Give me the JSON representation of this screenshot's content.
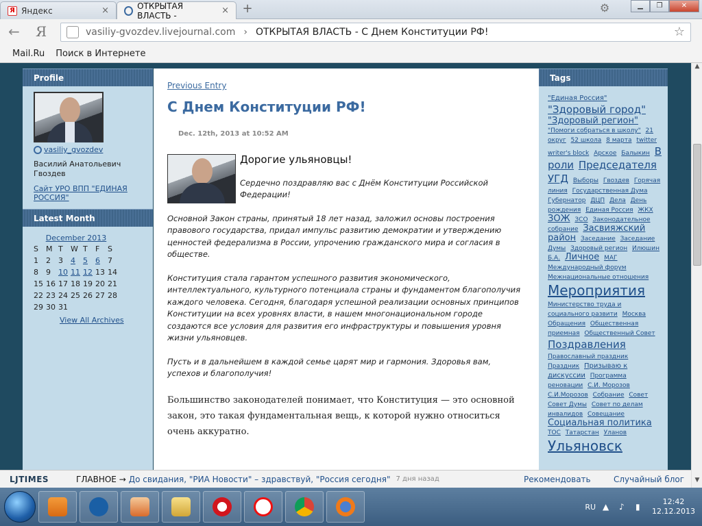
{
  "browser": {
    "tabs": [
      {
        "label": "Яндекс"
      },
      {
        "label": "ОТКРЫТАЯ ВЛАСТЬ - "
      }
    ],
    "new_tab_symbol": "+",
    "address_host": "vasiliy-gvozdev.livejournal.com",
    "address_separator": "›",
    "address_title": "ОТКРЫТАЯ ВЛАСТЬ - С Днем Конституции РФ!",
    "ya_button": "Я",
    "bookmarks": [
      "Mail.Ru",
      "Поиск в Интернете"
    ]
  },
  "sidebar_left": {
    "profile_heading": "Profile",
    "username": "vasiliy_gvozdev",
    "full_name": "Василий Анатольевич Гвоздев",
    "site_link": "Сайт УРО ВПП \"ЕДИНАЯ РОССИЯ\"",
    "latest_month_heading": "Latest Month",
    "calendar": {
      "month": "December 2013",
      "weekdays": [
        "S",
        "M",
        "T",
        "W",
        "T",
        "F",
        "S"
      ],
      "days": [
        [
          "1",
          "2",
          "3",
          "4",
          "5",
          "6",
          "7"
        ],
        [
          "8",
          "9",
          "10",
          "11",
          "12",
          "13",
          "14"
        ],
        [
          "15",
          "16",
          "17",
          "18",
          "19",
          "20",
          "21"
        ],
        [
          "22",
          "23",
          "24",
          "25",
          "26",
          "27",
          "28"
        ],
        [
          "29",
          "30",
          "31",
          "",
          "",
          "",
          ""
        ]
      ],
      "linked_days": [
        "4",
        "5",
        "6",
        "10",
        "11",
        "12"
      ],
      "view_all": "View All Archives"
    }
  },
  "entry": {
    "prev_entry": "Previous Entry",
    "title": "С Днем Конституции РФ!",
    "date": "Dec. 12th, 2013 at 10:52 AM",
    "greeting": "Дорогие ульяновцы!",
    "intro": "Сердечно поздравляю вас с Днём Конституции Российской Федерации!",
    "paragraphs": [
      "Основной Закон страны, принятый 18 лет назад, заложил основы построения правового государства, придал импульс развитию демократии и утверждению ценностей федерализма в России, упрочению гражданского мира и согласия в обществе.",
      "Конституция стала гарантом успешного развития экономического, интеллектуального, культурного потенциала страны и фундаментом благополучия каждого человека. Сегодня, благодаря успешной реализации основных принципов Конституции на всех уровнях власти, в нашем многонациональном городе создаются все условия для развития его инфраструктуры и повышения уровня жизни ульяновцев.",
      "Пусть и в дальнейшем в каждой семье царят мир и гармония. Здоровья вам, успехов и благополучия!"
    ],
    "closing": "Большинство законодателей понимает, что Конституция — это основной закон, это такая  фундаментальная вещь, к которой нужно относиться очень аккуратно."
  },
  "sidebar_right": {
    "tags_heading": "Tags",
    "tags": [
      {
        "t": "\"Единая Россия\"",
        "s": 2
      },
      {
        "t": "\"Здоровый город\"",
        "s": 4
      },
      {
        "t": "\"Здоровый регион\"",
        "s": 3
      },
      {
        "t": "\"Помоги собраться в школу\"",
        "s": 1
      },
      {
        "t": "21 округ",
        "s": 1
      },
      {
        "t": "52 школа",
        "s": 1
      },
      {
        "t": "8 марта",
        "s": 1
      },
      {
        "t": "twitter",
        "s": 1
      },
      {
        "t": "writer's block",
        "s": 1
      },
      {
        "t": "Арское",
        "s": 1
      },
      {
        "t": "Балыкин",
        "s": 1
      },
      {
        "t": "В роли",
        "s": 4
      },
      {
        "t": "Председателя УГД",
        "s": 4
      },
      {
        "t": "Выборы",
        "s": 1
      },
      {
        "t": "Гвоздев",
        "s": 1
      },
      {
        "t": "Горячая линия",
        "s": 1
      },
      {
        "t": "Государственная Дума",
        "s": 1
      },
      {
        "t": "Губернатор",
        "s": 1
      },
      {
        "t": "ДЦП",
        "s": 1
      },
      {
        "t": "Дела",
        "s": 1
      },
      {
        "t": "День рождения",
        "s": 1
      },
      {
        "t": "Единая Россия",
        "s": 1
      },
      {
        "t": "ЖКХ",
        "s": 1
      },
      {
        "t": "ЗОЖ",
        "s": 3
      },
      {
        "t": "ЗСО",
        "s": 1
      },
      {
        "t": "Законодательное собрание",
        "s": 1
      },
      {
        "t": "Засвияжский район",
        "s": 3
      },
      {
        "t": "Заседание",
        "s": 1
      },
      {
        "t": "Заседание Думы",
        "s": 1
      },
      {
        "t": "Здоровый регион",
        "s": 1
      },
      {
        "t": "Илюшин",
        "s": 1
      },
      {
        "t": "Б.А.",
        "s": 1
      },
      {
        "t": "Личное",
        "s": 3
      },
      {
        "t": "МАГ",
        "s": 1
      },
      {
        "t": "Международный форум",
        "s": 1
      },
      {
        "t": "Межнациональные отношения",
        "s": 1
      },
      {
        "t": "Мероприятия",
        "s": 5
      },
      {
        "t": "Министерство труда и социального развити",
        "s": 1
      },
      {
        "t": "Москва",
        "s": 1
      },
      {
        "t": "Обращения",
        "s": 1
      },
      {
        "t": "Общественная приемная",
        "s": 1
      },
      {
        "t": "Общественный Совет",
        "s": 1
      },
      {
        "t": "Поздравления",
        "s": 4
      },
      {
        "t": "Православный праздник",
        "s": 1
      },
      {
        "t": "Праздник",
        "s": 1
      },
      {
        "t": "Призываю к дискуссии",
        "s": 2
      },
      {
        "t": "Программа реновации",
        "s": 1
      },
      {
        "t": "С.И. Морозов",
        "s": 1
      },
      {
        "t": "С.И.Морозов",
        "s": 1
      },
      {
        "t": "Собрание",
        "s": 1
      },
      {
        "t": "Совет",
        "s": 1
      },
      {
        "t": "Совет Думы",
        "s": 1
      },
      {
        "t": "Совет по делам инвалидов",
        "s": 1
      },
      {
        "t": "Совещание",
        "s": 1
      },
      {
        "t": "Социальная политика",
        "s": 3
      },
      {
        "t": "ТОС",
        "s": 1
      },
      {
        "t": "Татарстан",
        "s": 1
      },
      {
        "t": "Уланов",
        "s": 1
      },
      {
        "t": "Ульяновск",
        "s": 5
      }
    ]
  },
  "ljbar": {
    "logo": "LJTIMES",
    "main": "ГЛАВНОЕ →",
    "news": "До свидания, \"РИА Новости\" – здравствуй, \"Россия сегодня\"",
    "ago": "7 дня назад",
    "recommend": "Рекомендовать",
    "random": "Случайный блог"
  },
  "taskbar": {
    "apps": [
      "media-player-icon",
      "hp-icon",
      "presentation-icon",
      "file-manager-icon",
      "opera-icon",
      "yandex-browser-icon",
      "chrome-icon",
      "firefox-icon"
    ],
    "lang": "RU",
    "time": "12:42",
    "date": "12.12.2013"
  }
}
